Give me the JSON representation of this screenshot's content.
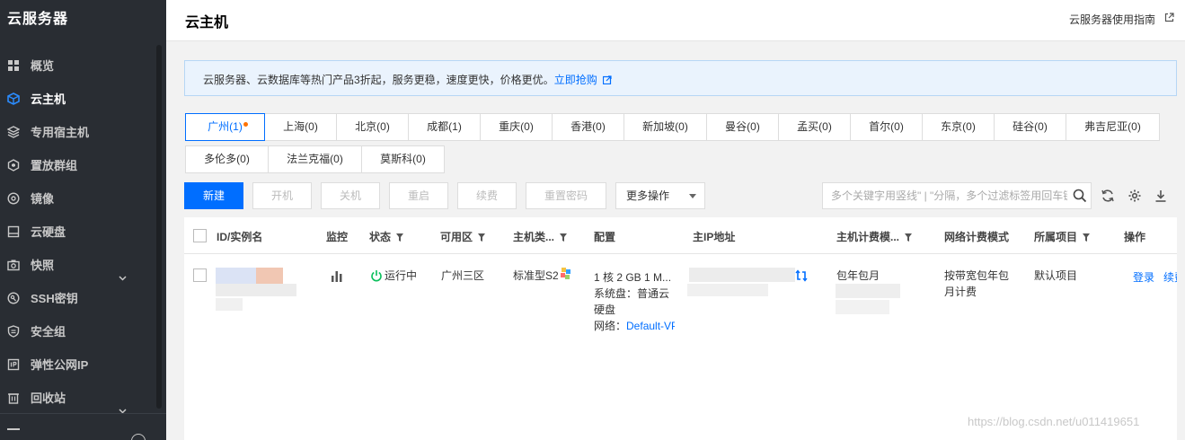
{
  "sidebar": {
    "brand": "云服务器",
    "items": [
      {
        "label": "概览"
      },
      {
        "label": "云主机"
      },
      {
        "label": "专用宿主机"
      },
      {
        "label": "置放群组"
      },
      {
        "label": "镜像"
      },
      {
        "label": "云硬盘"
      },
      {
        "label": "快照"
      },
      {
        "label": "SSH密钥"
      },
      {
        "label": "安全组"
      },
      {
        "label": "弹性公网IP"
      },
      {
        "label": "回收站"
      }
    ]
  },
  "header": {
    "title": "云主机",
    "guide_link": "云服务器使用指南"
  },
  "notice": {
    "text": "云服务器、云数据库等热门产品3折起，服务更稳，速度更快，价格更优。",
    "link": "立即抢购"
  },
  "regions": [
    {
      "label": "广州(1)"
    },
    {
      "label": "上海(0)"
    },
    {
      "label": "北京(0)"
    },
    {
      "label": "成都(1)"
    },
    {
      "label": "重庆(0)"
    },
    {
      "label": "香港(0)"
    },
    {
      "label": "新加坡(0)"
    },
    {
      "label": "曼谷(0)"
    },
    {
      "label": "孟买(0)"
    },
    {
      "label": "首尔(0)"
    },
    {
      "label": "东京(0)"
    },
    {
      "label": "硅谷(0)"
    },
    {
      "label": "弗吉尼亚(0)"
    },
    {
      "label": "多伦多(0)"
    },
    {
      "label": "法兰克福(0)"
    },
    {
      "label": "莫斯科(0)"
    }
  ],
  "toolbar": {
    "create": "新建",
    "start": "开机",
    "shutdown": "关机",
    "restart": "重启",
    "renew": "续费",
    "reset_password": "重置密码",
    "more_actions": "更多操作",
    "search_placeholder": "多个关键字用竖线\" | \"分隔，多个过滤标签用回车键分隔"
  },
  "table": {
    "columns": {
      "id": "ID/实例名",
      "monitor": "监控",
      "status": "状态",
      "zone": "可用区",
      "type": "主机类...",
      "config": "配置",
      "ip": "主IP地址",
      "billing": "主机计费模...",
      "net_billing": "网络计费模式",
      "project": "所属项目",
      "ops": "操作"
    },
    "rows": [
      {
        "status": "运行中",
        "zone": "广州三区",
        "type": "标准型S2",
        "config_line1": "1 核 2 GB 1 M...",
        "config_line2": "系统盘：普通云",
        "config_line3": "硬盘",
        "config_net_label": "网络：",
        "config_net_value": "Default-VPC",
        "billing": "包年包月",
        "net_billing_line1": "按带宽包年包",
        "net_billing_line2": "月计费",
        "project": "默认项目",
        "op_login": "登录",
        "op_renew": "续费"
      }
    ]
  },
  "watermark": "https://blog.csdn.net/u011419651"
}
